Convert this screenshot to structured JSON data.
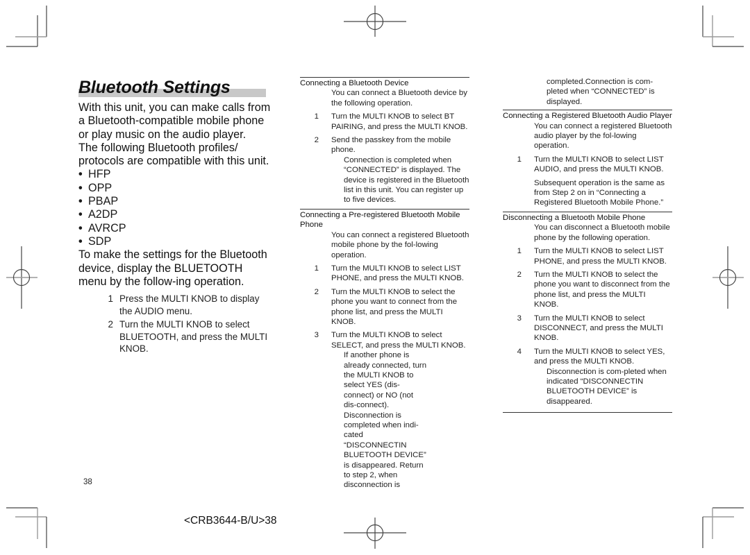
{
  "title": "Bluetooth Settings",
  "left": {
    "intro1": "With this unit, you can make calls from a Bluetooth-compatible mobile phone or play music on the audio player.",
    "intro2": "The following Bluetooth profiles/ protocols are compatible with this unit.",
    "profiles": [
      "HFP",
      "OPP",
      "PBAP",
      "A2DP",
      "AVRCP",
      "SDP"
    ],
    "bullet": "•",
    "intro3": "To make the settings for the Bluetooth device, display the BLUETOOTH menu by the follow-ing operation.",
    "steps": [
      {
        "num": "1",
        "text": "Press the MULTI KNOB to display the AUDIO menu."
      },
      {
        "num": "2",
        "text": "Turn the MULTI KNOB to select BLUETOOTH, and press the MULTI KNOB."
      }
    ]
  },
  "connect_device": {
    "heading": "Connecting a Bluetooth Device",
    "intro": "You can connect a Bluetooth device by the following operation.",
    "steps": [
      {
        "num": "1",
        "text": "Turn the MULTI KNOB to select BT PAIRING, and press the MULTI KNOB."
      },
      {
        "num": "2",
        "text": "Send the passkey from the mobile phone."
      }
    ],
    "step2_note": "Connection is completed when “CONNECTED” is displayed. The device is registered in the Bluetooth list in this unit. You can register up to five devices."
  },
  "connect_preregistered": {
    "heading": "Connecting a Pre-registered Bluetooth Mobile Phone",
    "intro": "You can connect a registered Bluetooth mobile phone by the fol-lowing operation.",
    "steps": [
      {
        "num": "1",
        "text": "Turn the MULTI KNOB to select LIST PHONE, and press the MULTI KNOB."
      },
      {
        "num": "2",
        "text": "Turn the MULTI KNOB to select the phone you want to connect from the phone list, and press the MULTI KNOB."
      },
      {
        "num": "3",
        "text": "Turn the MULTI KNOB to select SELECT, and press the MULTI KNOB."
      }
    ],
    "step3_note": "If another phone is already connected, turn the MULTI KNOB to select YES (dis-connect) or NO (not dis-connect). Disconnection is completed when indi-cated “DISCONNECTIN BLUETOOTH DEVICE” is disappeared. Return to step 2, when disconnection is",
    "step3_note_cont": "completed.Connection is com-pleted when “CONNECTED” is displayed."
  },
  "connect_audio": {
    "heading": "Connecting a Registered Bluetooth Audio Player",
    "intro": "You can connect a registered Bluetooth audio player by the fol-lowing operation.",
    "steps": [
      {
        "num": "1",
        "text": "Turn the MULTI KNOB to select LIST AUDIO, and press the MULTI KNOB."
      }
    ],
    "note": "Subsequent operation is the same as from Step 2 on in “Connecting a Registered Bluetooth Mobile Phone.”"
  },
  "disconnect_phone": {
    "heading": "Disconnecting a Bluetooth Mobile Phone",
    "intro": "You can disconnect a Bluetooth mobile phone by the following operation.",
    "steps": [
      {
        "num": "1",
        "text": "Turn the MULTI KNOB to select LIST PHONE, and press the MULTI KNOB."
      },
      {
        "num": "2",
        "text": "Turn the MULTI KNOB to select the phone you want to disconnect from the phone list, and press the MULTI KNOB."
      },
      {
        "num": "3",
        "text": "Turn the MULTI KNOB to select DISCONNECT, and press the MULTI KNOB."
      },
      {
        "num": "4",
        "text": "Turn the MULTI KNOB to select YES, and press the MULTI KNOB."
      }
    ],
    "step4_note": "Disconnection is com-pleted when indicated “DISCONNECTIN BLUETOOTH DEVICE” is disappeared."
  },
  "footer": {
    "page_number": "38",
    "doc_code": "<CRB3644-B/U>38"
  }
}
